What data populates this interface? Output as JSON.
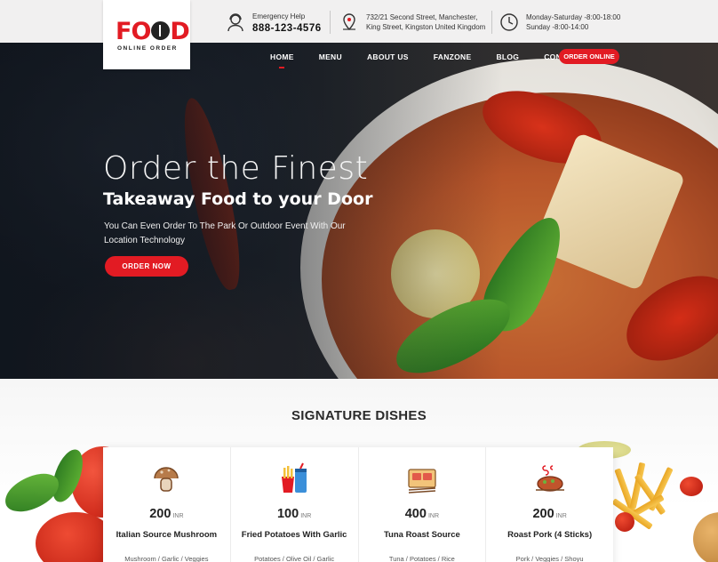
{
  "brand": {
    "logo_text_start": "F",
    "logo_text_o1": "O",
    "logo_text_end": "D",
    "logo_subtitle": "ONLINE ORDER",
    "accent_color": "#e21b23"
  },
  "topbar": {
    "emergency_label": "Emergency Help",
    "emergency_phone": "888-123-4576",
    "address_line1": "732/21 Second Street, Manchester,",
    "address_line2": "King Street, Kingston United Kingdom",
    "hours_line1": "Monday-Saturday -8:00-18:00",
    "hours_line2": "Sunday -8:00-14:00",
    "icons": [
      "support-agent-icon",
      "map-pin-icon",
      "clock-icon"
    ]
  },
  "nav": {
    "items": [
      {
        "label": "HOME",
        "active": true
      },
      {
        "label": "MENU",
        "active": false
      },
      {
        "label": "ABOUT US",
        "active": false
      },
      {
        "label": "FANZONE",
        "active": false
      },
      {
        "label": "BLOG",
        "active": false
      },
      {
        "label": "CONTACT US",
        "active": false
      }
    ],
    "order_online_label": "ORDER ONLINE"
  },
  "hero": {
    "heading_thin": "Order the Finest",
    "heading_bold": "Takeaway Food to your Door",
    "description": "You Can Even Order To The Park Or Outdoor Event With Our Location Technology",
    "cta_label": "ORDER NOW"
  },
  "signature": {
    "title": "SIGNATURE DISHES",
    "dishes": [
      {
        "icon": "mushroom-icon",
        "price": "200",
        "currency": "INR",
        "name": "Italian Source Mushroom",
        "ingredients": "Mushroom / Garlic / Veggies"
      },
      {
        "icon": "fries-drink-icon",
        "price": "100",
        "currency": "INR",
        "name": "Fried Potatoes With Garlic",
        "ingredients": "Potatoes / Olive Oil / Garlic"
      },
      {
        "icon": "tuna-sushi-icon",
        "price": "400",
        "currency": "INR",
        "name": "Tuna Roast Source",
        "ingredients": "Tuna / Potatoes / Rice"
      },
      {
        "icon": "roast-pork-icon",
        "price": "200",
        "currency": "INR",
        "name": "Roast Pork (4 Sticks)",
        "ingredients": "Pork / Veggies / Shoyu"
      }
    ]
  }
}
